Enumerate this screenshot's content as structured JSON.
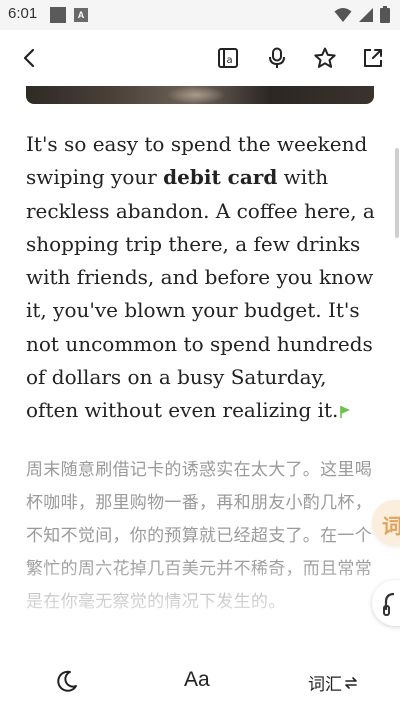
{
  "status_bar": {
    "time": "6:01",
    "notification_badge": "A",
    "icons": [
      "wifi-icon",
      "signal-icon",
      "battery-icon"
    ]
  },
  "toolbar": {
    "icons": [
      "back-arrow-icon",
      "reader-mode-icon",
      "microphone-icon",
      "star-icon",
      "share-icon"
    ]
  },
  "article": {
    "en_before_bold": "It's so easy to spend the weekend swiping your ",
    "en_bold": "debit card",
    "en_after_bold": " with reckless abandon. A coffee here, a shopping trip there, a few drinks with friends, and before you know it, you've blown your budget. It's not uncommon to spend hundreds of dollars on a busy Saturday, often without even realizing it.",
    "zh_translation": "周末随意刷借记卡的诱惑实在太大了。这里喝杯咖啡，那里购物一番，再和朋友小酌几杯，不知不觉间，你的预算就已经超支了。在一个繁忙的周六花掉几百美元并不稀奇，而且常常是在你毫无察觉的情况下发生的。"
  },
  "side_tabs": {
    "vocab_label": "词"
  },
  "bottom_bar": {
    "font_label": "Aa",
    "vocab_label": "词汇"
  },
  "colors": {
    "accent_flag": "#6cc24a",
    "vocab_tab": "#e2a35b",
    "translation_text": "#9a9a9a"
  }
}
